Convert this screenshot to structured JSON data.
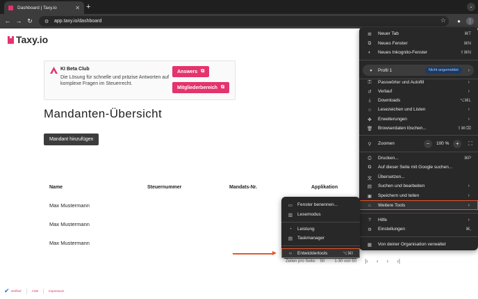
{
  "browser": {
    "tab_title": "Dashboard | Taxy.io",
    "tab_close": "✕",
    "new_tab": "+",
    "url": "app.taxy.io/dashboard"
  },
  "page": {
    "logo_text": "Taxy.io",
    "beta": {
      "title": "KI Beta Club",
      "description": "Die Lösung für schnelle und präzise Antworten auf komplexe Fragen im Steuerrecht.",
      "answers_btn": "Answers",
      "member_btn": "Mitgliederbereich"
    },
    "title": "Mandanten-Übersicht",
    "add_btn": "Mandant hinzufügen",
    "table": {
      "headers": [
        "Name",
        "Steuernummer",
        "Mandats-Nr.",
        "Applikation"
      ],
      "rows": [
        "Max Mustermann",
        "Max Mustermann",
        "Max Mustermann"
      ]
    },
    "pagination": {
      "per_page_label": "Zeilen pro Seite:",
      "per_page": "50",
      "range": "1-30 von 50"
    },
    "footer": {
      "verified": "Verified",
      "agb": "AGB",
      "impressum": "Impressum"
    }
  },
  "menu": {
    "new_tab": {
      "label": "Neuer Tab",
      "shortcut": "⌘T"
    },
    "new_window": {
      "label": "Neues Fenster",
      "shortcut": "⌘N"
    },
    "incognito": {
      "label": "Neues Inkognito-Fenster",
      "shortcut": "⇧⌘N"
    },
    "profile": {
      "label": "Profil 1",
      "badge": "Nicht angemeldet"
    },
    "passwords": {
      "label": "Passwörter und Autofill"
    },
    "history": {
      "label": "Verlauf"
    },
    "downloads": {
      "label": "Downloads",
      "shortcut": "⌥⌘L"
    },
    "bookmarks": {
      "label": "Lesezeichen und Listen"
    },
    "extensions": {
      "label": "Erweiterungen"
    },
    "clear_data": {
      "label": "Browserdaten löschen...",
      "shortcut": "⇧⌘⌫"
    },
    "zoom": {
      "label": "Zoomen",
      "minus": "−",
      "value": "100 %",
      "plus": "+"
    },
    "print": {
      "label": "Drucken...",
      "shortcut": "⌘P"
    },
    "google_search": {
      "label": "Auf dieser Seite mit Google suchen..."
    },
    "translate": {
      "label": "Übersetzen..."
    },
    "find_edit": {
      "label": "Suchen und bearbeiten"
    },
    "save_share": {
      "label": "Speichern und teilen"
    },
    "more_tools": {
      "label": "Weitere Tools"
    },
    "help": {
      "label": "Hilfe"
    },
    "settings": {
      "label": "Einstellungen",
      "shortcut": "⌘,"
    },
    "managed": {
      "label": "Von deiner Organisation verwaltet"
    }
  },
  "submenu": {
    "name_window": {
      "label": "Fenster benennen..."
    },
    "reading_mode": {
      "label": "Lesemodus"
    },
    "performance": {
      "label": "Leistung"
    },
    "task_manager": {
      "label": "Taskmanager"
    },
    "devtools": {
      "label": "Entwicklertools",
      "shortcut": "⌥⌘I"
    }
  },
  "colors": {
    "brand": "#e4336d",
    "highlight": "#e8542c",
    "menu_bg": "#282828"
  }
}
